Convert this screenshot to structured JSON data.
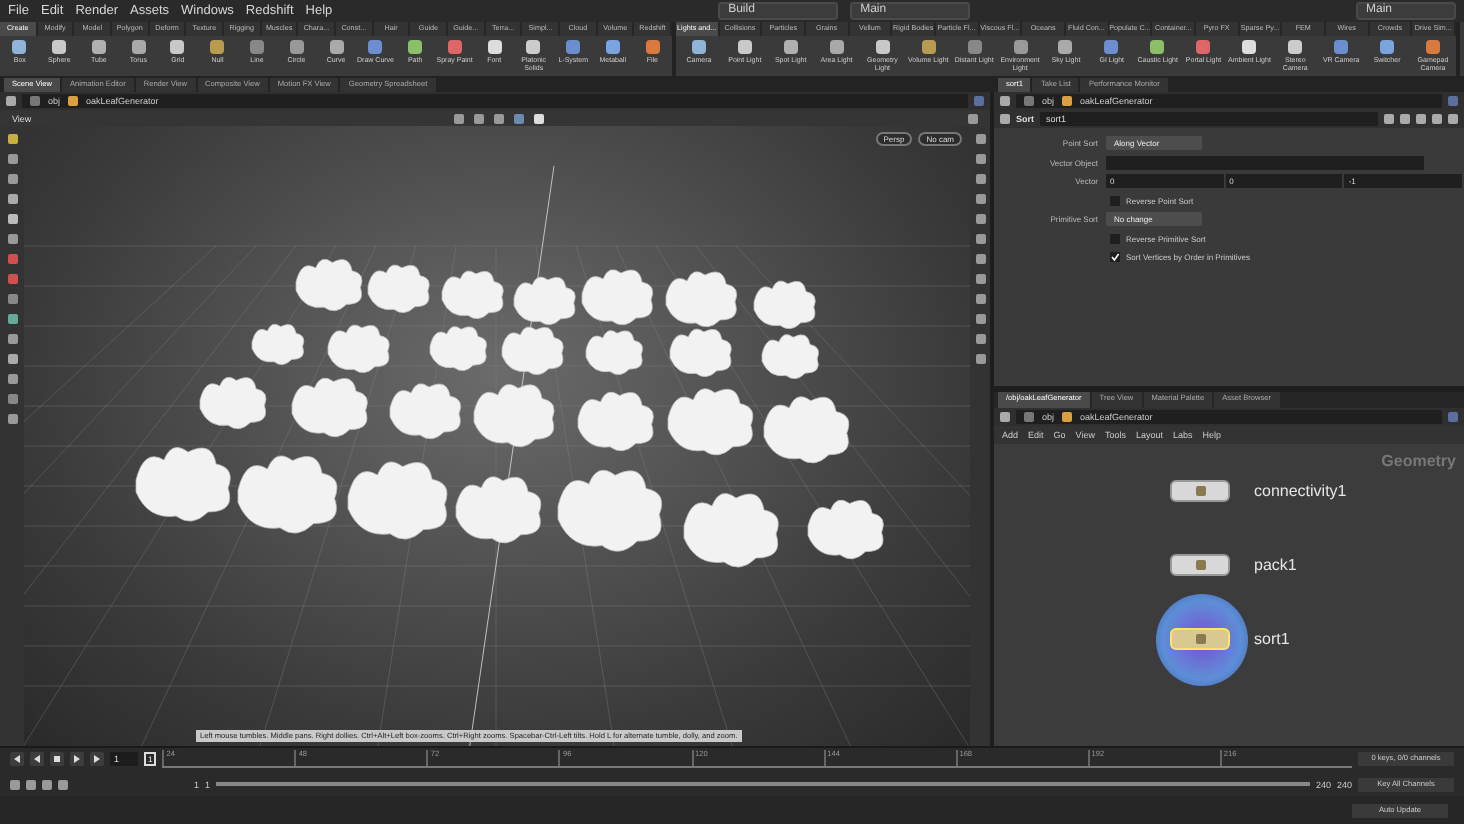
{
  "menu_bar": {
    "items": [
      "File",
      "Edit",
      "Render",
      "Assets",
      "Windows",
      "Redshift",
      "Help"
    ],
    "desktop_left": "Build",
    "desktop_center": "Main",
    "desktop_right": "Main"
  },
  "shelf_left": {
    "tabs": [
      {
        "label": "Create",
        "selected": true
      },
      {
        "label": "Modify",
        "selected": false
      },
      {
        "label": "Model",
        "selected": false
      },
      {
        "label": "Polygon",
        "selected": false
      },
      {
        "label": "Deform",
        "selected": false
      },
      {
        "label": "Texture",
        "selected": false
      },
      {
        "label": "Rigging",
        "selected": false
      },
      {
        "label": "Muscles",
        "selected": false
      },
      {
        "label": "Chara...",
        "selected": false
      },
      {
        "label": "Const...",
        "selected": false
      },
      {
        "label": "Hair",
        "selected": false
      },
      {
        "label": "Guide",
        "selected": false
      },
      {
        "label": "Guide...",
        "selected": false
      },
      {
        "label": "Terra...",
        "selected": false
      },
      {
        "label": "Simpl...",
        "selected": false
      },
      {
        "label": "Cloud",
        "selected": false
      },
      {
        "label": "Volume",
        "selected": false
      },
      {
        "label": "Redshift",
        "selected": false
      }
    ],
    "tools": [
      "Box",
      "Sphere",
      "Tube",
      "Torus",
      "Grid",
      "Null",
      "Line",
      "Circle",
      "Curve",
      "Draw Curve",
      "Path",
      "Spray Paint",
      "Font",
      "Platonic Solids",
      "L-System",
      "Metaball",
      "File"
    ]
  },
  "shelf_right": {
    "tabs": [
      {
        "label": "Lights and...",
        "selected": true
      },
      {
        "label": "Collisions",
        "selected": false
      },
      {
        "label": "Particles",
        "selected": false
      },
      {
        "label": "Grains",
        "selected": false
      },
      {
        "label": "Vellum",
        "selected": false
      },
      {
        "label": "Rigid Bodies",
        "selected": false
      },
      {
        "label": "Particle Fl...",
        "selected": false
      },
      {
        "label": "Viscous Fl...",
        "selected": false
      },
      {
        "label": "Oceans",
        "selected": false
      },
      {
        "label": "Fluid Con...",
        "selected": false
      },
      {
        "label": "Populate C...",
        "selected": false
      },
      {
        "label": "Container...",
        "selected": false
      },
      {
        "label": "Pyro FX",
        "selected": false
      },
      {
        "label": "Sparse Py...",
        "selected": false
      },
      {
        "label": "FEM",
        "selected": false
      },
      {
        "label": "Wires",
        "selected": false
      },
      {
        "label": "Crowds",
        "selected": false
      },
      {
        "label": "Drive Sim...",
        "selected": false
      }
    ],
    "tools": [
      "Camera",
      "Point Light",
      "Spot Light",
      "Area Light",
      "Geometry Light",
      "Volume Light",
      "Distant Light",
      "Environment Light",
      "Sky Light",
      "GI Light",
      "Caustic Light",
      "Portal Light",
      "Ambient Light",
      "Stereo Camera",
      "VR Camera",
      "Switcher",
      "Gamepad Camera"
    ]
  },
  "pane_tabs_left": [
    {
      "label": "Scene View",
      "selected": true
    },
    {
      "label": "Animation Editor",
      "selected": false
    },
    {
      "label": "Render View",
      "selected": false
    },
    {
      "label": "Composite View",
      "selected": false
    },
    {
      "label": "Motion FX View",
      "selected": false
    },
    {
      "label": "Geometry Spreadsheet",
      "selected": false
    }
  ],
  "pane_tabs_right": [
    {
      "label": "sort1",
      "selected": true
    },
    {
      "label": "Take List",
      "selected": false
    },
    {
      "label": "Performance Monitor",
      "selected": false
    }
  ],
  "viewport": {
    "path": [
      "obj",
      "oakLeafGenerator"
    ],
    "title": "View",
    "camera_buttons": [
      "Persp",
      "No cam"
    ],
    "status": "Left mouse tumbles. Middle pans. Right dollies. Ctrl+Alt+Left box-zooms. Ctrl+Right zooms. Spacebar-Ctrl-Left tilts. Hold L for alternate tumble, dolly, and zoom."
  },
  "parameters": {
    "path": [
      "obj",
      "oakLeafGenerator"
    ],
    "node_type": "Sort",
    "node_name": "sort1",
    "rows": [
      {
        "kind": "menu",
        "label": "Point Sort",
        "value": "Along Vector"
      },
      {
        "kind": "text",
        "label": "Vector Object"
      },
      {
        "kind": "vector",
        "label": "Vector",
        "values": [
          "0",
          "0",
          "-1"
        ]
      },
      {
        "kind": "check",
        "label": "Reverse Point Sort",
        "checked": false
      },
      {
        "kind": "menu",
        "label": "Primitive Sort",
        "value": "No change"
      },
      {
        "kind": "check",
        "label": "Reverse Primitive Sort",
        "checked": false
      },
      {
        "kind": "check",
        "label": "Sort Vertices by Order in Primitives",
        "checked": true
      }
    ]
  },
  "network": {
    "tabs": [
      {
        "label": "/obj/oakLeafGenerator",
        "selected": true
      },
      {
        "label": "Tree View",
        "selected": false
      },
      {
        "label": "Material Palette",
        "selected": false
      },
      {
        "label": "Asset Browser",
        "selected": false
      }
    ],
    "path": [
      "obj",
      "oakLeafGenerator"
    ],
    "menu": [
      "Add",
      "Edit",
      "Go",
      "View",
      "Tools",
      "Layout",
      "Labs",
      "Help"
    ],
    "context": "Geometry",
    "nodes": [
      {
        "name": "connectivity1",
        "selected": false
      },
      {
        "name": "pack1",
        "selected": false
      },
      {
        "name": "sort1",
        "selected": true
      }
    ]
  },
  "timeline": {
    "frame": "1",
    "marker": "1",
    "ticks": [
      "24",
      "48",
      "72",
      "96",
      "120",
      "144",
      "168",
      "192",
      "216"
    ],
    "range_start": "1",
    "range_start_2": "1",
    "range_end": "240",
    "range_end_2": "240",
    "keys_status": "0 keys, 0/0 channels",
    "key_mode": "Key All Channels",
    "update_mode": "Auto Update"
  }
}
